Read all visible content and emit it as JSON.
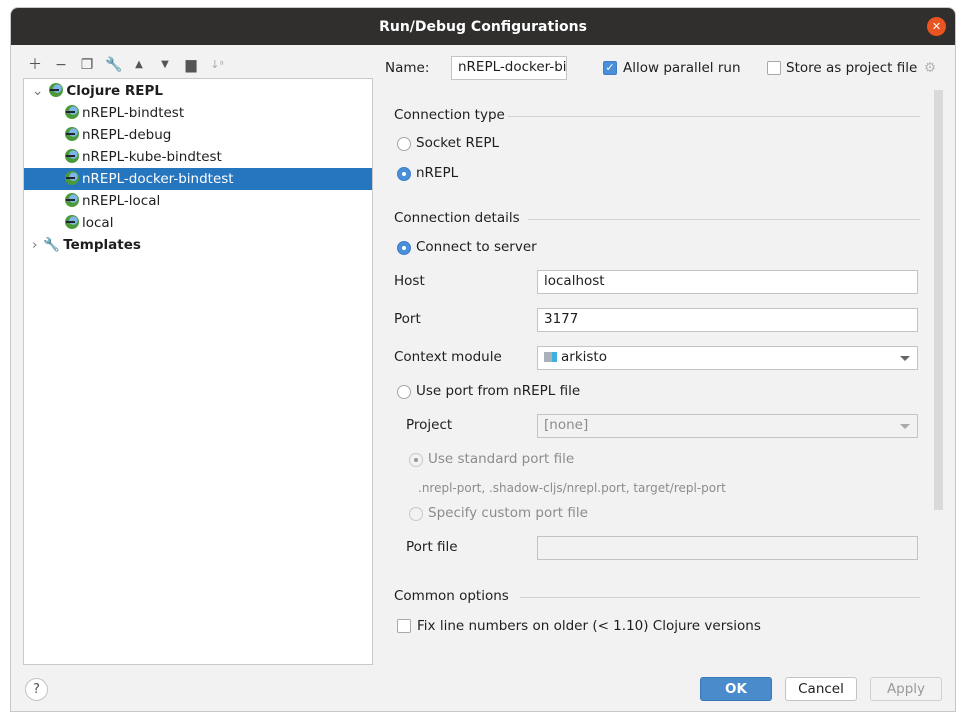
{
  "window": {
    "title": "Run/Debug Configurations"
  },
  "toolbar": {
    "icons": [
      "add-icon",
      "remove-icon",
      "copy-icon",
      "wrench-icon",
      "move-up-icon",
      "move-down-icon",
      "new-folder-icon",
      "sort-icon"
    ]
  },
  "tree": {
    "root": "Clojure REPL",
    "items": [
      {
        "label": "nREPL-bindtest",
        "selected": false
      },
      {
        "label": "nREPL-debug",
        "selected": false
      },
      {
        "label": "nREPL-kube-bindtest",
        "selected": false
      },
      {
        "label": "nREPL-docker-bindtest",
        "selected": true
      },
      {
        "label": "nREPL-local",
        "selected": false
      },
      {
        "label": "local",
        "selected": false
      }
    ],
    "templates": "Templates"
  },
  "header": {
    "name_label": "Name:",
    "name_value": "nREPL-docker-bindtest",
    "allow_parallel": "Allow parallel run",
    "allow_parallel_checked": true,
    "store_project": "Store as project file",
    "store_project_checked": false
  },
  "connection_type": {
    "title": "Connection type",
    "socket": "Socket REPL",
    "nrepl": "nREPL",
    "selected": "nREPL"
  },
  "connection_details": {
    "title": "Connection details",
    "connect_server": "Connect to server",
    "host_label": "Host",
    "host_value": "localhost",
    "port_label": "Port",
    "port_value": "3177",
    "module_label": "Context module",
    "module_value": "arkisto",
    "use_port_file": "Use port from nREPL file",
    "project_label": "Project",
    "project_value": "[none]",
    "use_standard": "Use standard port file",
    "standard_hint": ".nrepl-port, .shadow-cljs/nrepl.port, target/repl-port",
    "specify_custom": "Specify custom port file",
    "port_file_label": "Port file",
    "port_file_value": ""
  },
  "common": {
    "title": "Common options",
    "fix_lines": "Fix line numbers on older (< 1.10) Clojure versions",
    "fix_lines_checked": false
  },
  "footer": {
    "help": "?",
    "ok": "OK",
    "cancel": "Cancel",
    "apply": "Apply"
  },
  "colors": {
    "accent": "#4a90d9",
    "selection": "#2675bf",
    "titlebar": "#302f2e",
    "close": "#e95420"
  }
}
